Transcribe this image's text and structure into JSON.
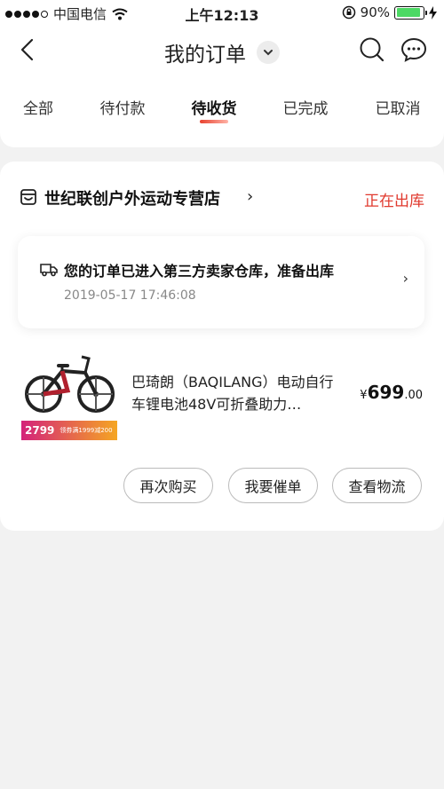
{
  "status_bar": {
    "carrier": "中国电信",
    "time": "上午12:13",
    "battery": "90%",
    "battery_level": 0.9
  },
  "header": {
    "title": "我的订单",
    "icons": [
      "back-icon",
      "chevron-down-icon",
      "search-icon",
      "chat-icon"
    ]
  },
  "tabs": [
    {
      "label": "全部"
    },
    {
      "label": "待付款"
    },
    {
      "label": "待收货"
    },
    {
      "label": "已完成"
    },
    {
      "label": "已取消"
    }
  ],
  "active_tab": "待收货",
  "order": {
    "store_name": "世纪联创户外运动专营店",
    "store_chevron": "›",
    "status": "正在出库",
    "logistics": {
      "text": "您的订单已进入第三方卖家仓库，准备出库",
      "time": "2019-05-17 17:46:08",
      "chevron": "›"
    },
    "product": {
      "title": "巴琦朗（BAQILANG）电动自行车锂电池48V可折叠助力…",
      "price_symbol": "¥",
      "price_int": "699",
      "price_dec": ".00",
      "thumb_price": "2799",
      "thumb_promo": "领券满1999减200"
    },
    "actions": [
      "再次购买",
      "我要催单",
      "查看物流"
    ]
  },
  "colors": {
    "accent": "#e0392e",
    "background": "#f2f2f2"
  }
}
